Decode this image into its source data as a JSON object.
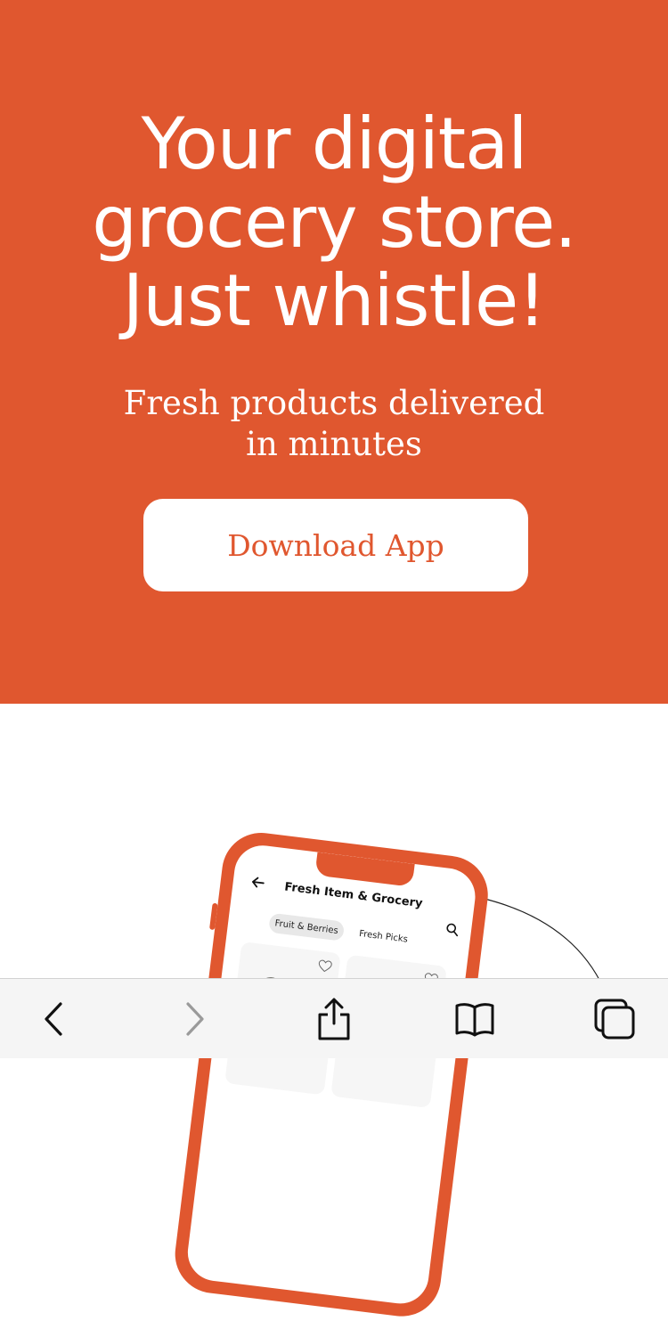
{
  "hero": {
    "title_lines": [
      "Your digital",
      "grocery store.",
      "Just whistle!"
    ],
    "subtitle_lines": [
      "Fresh products delivered",
      "in minutes"
    ],
    "cta_label": "Download App"
  },
  "phone_mockup": {
    "title": "Fresh Item & Grocery",
    "chips": [
      "Fruit & Berries",
      "Fresh Picks"
    ]
  },
  "toolbar": {
    "icons": [
      "back-icon",
      "forward-icon",
      "share-icon",
      "bookmarks-icon",
      "tabs-icon"
    ]
  },
  "colors": {
    "brand": "#e0572f",
    "white": "#ffffff",
    "toolbar_bg": "#f5f5f5",
    "toolbar_icon": "#111111",
    "toolbar_icon_disabled": "#9a9a9a"
  }
}
